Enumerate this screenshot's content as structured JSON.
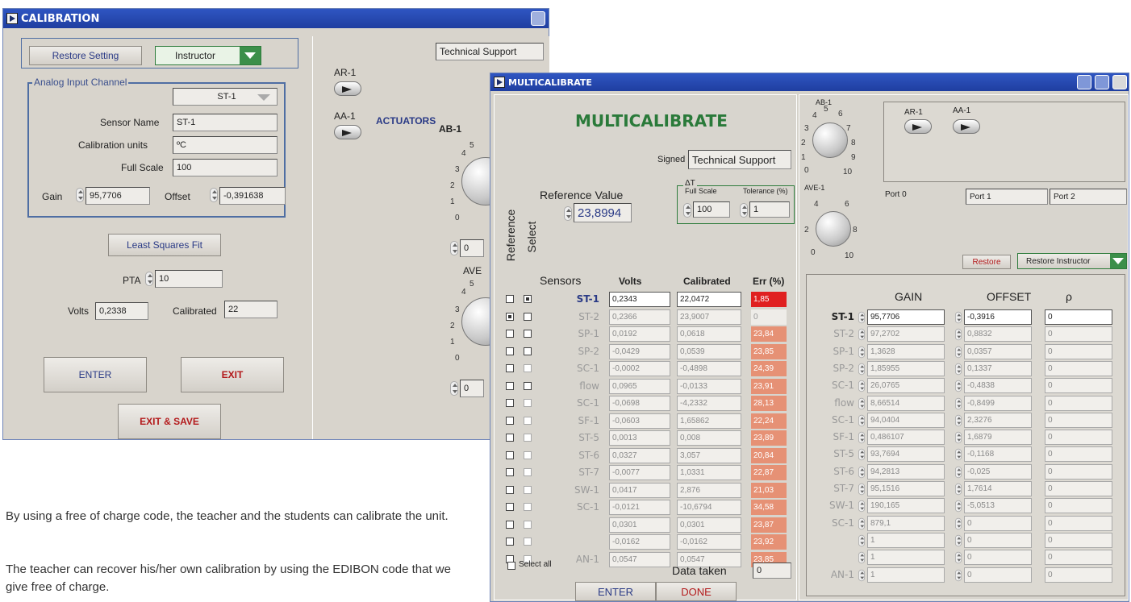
{
  "calibration": {
    "title": "CALIBRATION",
    "restore_setting": "Restore Setting",
    "role": "Instructor",
    "tech_support": "Technical Support",
    "analog_input_channel": "Analog Input Channel",
    "channel": "ST-1",
    "sensor_name_label": "Sensor Name",
    "sensor_name": "ST-1",
    "cal_units_label": "Calibration units",
    "cal_units": "ºC",
    "full_scale_label": "Full Scale",
    "full_scale": "100",
    "gain_label": "Gain",
    "gain": "95,7706",
    "offset_label": "Offset",
    "offset": "-0,391638",
    "least_squares": "Least Squares Fit",
    "pta_label": "PTA",
    "pta": "10",
    "volts_label": "Volts",
    "volts": "0,2338",
    "calibrated_label": "Calibrated",
    "calibrated": "22",
    "enter": "ENTER",
    "exit": "EXIT",
    "exit_save": "EXIT & SAVE",
    "ar1": "AR-1",
    "aa1": "AA-1",
    "actuators": "ACTUATORS",
    "ab1": "AB-1",
    "ave": "AVE",
    "dial_val_1": "0",
    "dial_val_2": "0",
    "dial_ticks": [
      "4",
      "5",
      "3",
      "2",
      "1",
      "0"
    ]
  },
  "caption": {
    "p1": "By using a free of charge code, the teacher and the students can calibrate the unit.",
    "p2": "The teacher can recover his/her own calibration by using the EDIBON code that we give free of charge."
  },
  "multi": {
    "title": "MULTICALIBRATE",
    "heading": "MULTICALIBRATE",
    "signed_label": "Signed",
    "signed": "Technical Support",
    "ref_value_label": "Reference Value",
    "ref_value": "23,8994",
    "delta_t": "ΔT",
    "full_scale_label": "Full Scale",
    "full_scale": "100",
    "tolerance_label": "Tolerance (%)",
    "tolerance": "1",
    "reference_label": "Reference",
    "select_label": "Select",
    "col_sensors": "Sensors",
    "col_volts": "Volts",
    "col_calibrated": "Calibrated",
    "col_err": "Err (%)",
    "rows": [
      {
        "sensor": "ST-1",
        "volts": "0,2343",
        "cal": "22,0472",
        "err": "1,85",
        "ref": false,
        "sel": true,
        "live": true
      },
      {
        "sensor": "ST-2",
        "volts": "0,2366",
        "cal": "23,9007",
        "err": "0",
        "ref": true,
        "sel": false,
        "live": false
      },
      {
        "sensor": "SP-1",
        "volts": "0,0192",
        "cal": "0,0618",
        "err": "23,84",
        "ref": false,
        "sel": false,
        "live": false
      },
      {
        "sensor": "SP-2",
        "volts": "-0,0429",
        "cal": "0,0539",
        "err": "23,85",
        "ref": false,
        "sel": false,
        "live": false
      },
      {
        "sensor": "SC-1",
        "volts": "-0,0002",
        "cal": "-0,4898",
        "err": "24,39",
        "ref": false,
        "sel": false,
        "live": false
      },
      {
        "sensor": "flow",
        "volts": "0,0965",
        "cal": "-0,0133",
        "err": "23,91",
        "ref": false,
        "sel": false,
        "live": false
      },
      {
        "sensor": "SC-1",
        "volts": "-0,0698",
        "cal": "-4,2332",
        "err": "28,13",
        "ref": false,
        "sel": false,
        "live": false
      },
      {
        "sensor": "SF-1",
        "volts": "-0,0603",
        "cal": "1,65862",
        "err": "22,24",
        "ref": false,
        "sel": false,
        "live": false
      },
      {
        "sensor": "ST-5",
        "volts": "0,0013",
        "cal": "0,008",
        "err": "23,89",
        "ref": false,
        "sel": false,
        "live": false
      },
      {
        "sensor": "ST-6",
        "volts": "0,0327",
        "cal": "3,057",
        "err": "20,84",
        "ref": false,
        "sel": false,
        "live": false
      },
      {
        "sensor": "ST-7",
        "volts": "-0,0077",
        "cal": "1,0331",
        "err": "22,87",
        "ref": false,
        "sel": false,
        "live": false
      },
      {
        "sensor": "SW-1",
        "volts": "0,0417",
        "cal": "2,876",
        "err": "21,03",
        "ref": false,
        "sel": false,
        "live": false
      },
      {
        "sensor": "SC-1",
        "volts": "-0,0121",
        "cal": "-10,6794",
        "err": "34,58",
        "ref": false,
        "sel": false,
        "live": false
      },
      {
        "sensor": "",
        "volts": "0,0301",
        "cal": "0,0301",
        "err": "23,87",
        "ref": false,
        "sel": false,
        "live": false
      },
      {
        "sensor": "",
        "volts": "-0,0162",
        "cal": "-0,0162",
        "err": "23,92",
        "ref": false,
        "sel": false,
        "live": false
      },
      {
        "sensor": "AN-1",
        "volts": "0,0547",
        "cal": "0,0547",
        "err": "23,85",
        "ref": false,
        "sel": false,
        "live": false
      }
    ],
    "select_all": "Select all",
    "data_taken_label": "Data taken",
    "data_taken": "0",
    "enter": "ENTER",
    "done": "DONE",
    "ab1": "AB-1",
    "ave1": "AVE-1",
    "ar1": "AR-1",
    "aa1": "AA-1",
    "port0": "Port 0",
    "port1": "Port 1",
    "port2": "Port 2",
    "restore": "Restore",
    "restore_instructor": "Restore Instructor",
    "col_gain": "GAIN",
    "col_offset": "OFFSET",
    "col_rho": "ρ",
    "gain_rows": [
      {
        "sensor": "ST-1",
        "gain": "95,7706",
        "offset": "-0,3916",
        "rho": "0",
        "live": true
      },
      {
        "sensor": "ST-2",
        "gain": "97,2702",
        "offset": "0,8832",
        "rho": "0",
        "live": false
      },
      {
        "sensor": "SP-1",
        "gain": "1,3628",
        "offset": "0,0357",
        "rho": "0",
        "live": false
      },
      {
        "sensor": "SP-2",
        "gain": "1,85955",
        "offset": "0,1337",
        "rho": "0",
        "live": false
      },
      {
        "sensor": "SC-1",
        "gain": "26,0765",
        "offset": "-0,4838",
        "rho": "0",
        "live": false
      },
      {
        "sensor": "flow",
        "gain": "8,66514",
        "offset": "-0,8499",
        "rho": "0",
        "live": false
      },
      {
        "sensor": "SC-1",
        "gain": "94,0404",
        "offset": "2,3276",
        "rho": "0",
        "live": false
      },
      {
        "sensor": "SF-1",
        "gain": "0,486107",
        "offset": "1,6879",
        "rho": "0",
        "live": false
      },
      {
        "sensor": "ST-5",
        "gain": "93,7694",
        "offset": "-0,1168",
        "rho": "0",
        "live": false
      },
      {
        "sensor": "ST-6",
        "gain": "94,2813",
        "offset": "-0,025",
        "rho": "0",
        "live": false
      },
      {
        "sensor": "ST-7",
        "gain": "95,1516",
        "offset": "1,7614",
        "rho": "0",
        "live": false
      },
      {
        "sensor": "SW-1",
        "gain": "190,165",
        "offset": "-5,0513",
        "rho": "0",
        "live": false
      },
      {
        "sensor": "SC-1",
        "gain": "879,1",
        "offset": "0",
        "rho": "0",
        "live": false
      },
      {
        "sensor": "",
        "gain": "1",
        "offset": "0",
        "rho": "0",
        "live": false
      },
      {
        "sensor": "",
        "gain": "1",
        "offset": "0",
        "rho": "0",
        "live": false
      },
      {
        "sensor": "AN-1",
        "gain": "1",
        "offset": "0",
        "rho": "0",
        "live": false
      }
    ],
    "ab_ticks": [
      "4",
      "5",
      "6",
      "3",
      "7",
      "2",
      "8",
      "1",
      "9",
      "0",
      "10"
    ],
    "ave_ticks": [
      "4",
      "6",
      "2",
      "8",
      "0",
      "10"
    ]
  }
}
